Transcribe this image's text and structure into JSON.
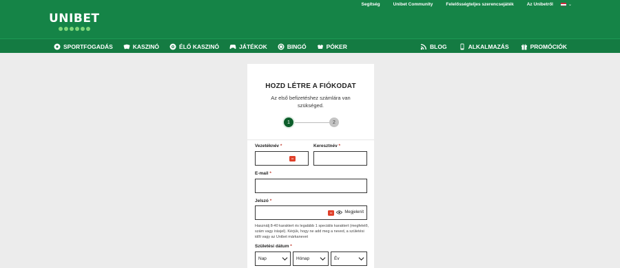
{
  "brand": {
    "name": "UNIBET"
  },
  "toplinks": [
    "Segítség",
    "Unibet Community",
    "Felelősségteljes szerencsejáték",
    "Az Unibetről"
  ],
  "language": {
    "flag_colors": [
      "#cd2a3e",
      "#ffffff",
      "#436f4d"
    ]
  },
  "nav": {
    "left": [
      {
        "label": "SPORTFOGADÁS",
        "icon": "sports-icon"
      },
      {
        "label": "KASZINÓ",
        "icon": "casino-icon"
      },
      {
        "label": "ÉLŐ KASZINÓ",
        "icon": "live-casino-icon"
      },
      {
        "label": "JÁTÉKOK",
        "icon": "games-icon"
      },
      {
        "label": "BINGÓ",
        "icon": "bingo-icon"
      },
      {
        "label": "PÓKER",
        "icon": "poker-icon"
      }
    ],
    "right": [
      {
        "label": "BLOG",
        "icon": "rss-icon"
      },
      {
        "label": "ALKALMAZÁS",
        "icon": "phone-icon"
      },
      {
        "label": "PROMÓCIÓK",
        "icon": "gift-icon"
      }
    ]
  },
  "form": {
    "title": "HOZD LÉTRE A FIÓKODAT",
    "subtitle": "Az első befizetéshez számlára van szükséged.",
    "steps": [
      "1",
      "2"
    ],
    "current_step": 1,
    "fields": {
      "lastname": {
        "label": "Vezetéknév",
        "value": ""
      },
      "firstname": {
        "label": "Keresztnév",
        "value": ""
      },
      "email": {
        "label": "E-mail",
        "value": ""
      },
      "password": {
        "label": "Jelszó",
        "value": "",
        "show_label": "Megjelenít"
      },
      "password_hint": "Használj 8-40 karaktert és legalább 1 speciális karaktert (megfelelő, szám vagy írásjel). Kérjük, hogy ne add meg a neved, a születési időt vagy az Unibet márkanevet",
      "birthdate": {
        "label": "Születési dátum",
        "day": "Nap",
        "month": "Hónap",
        "year": "Év"
      }
    },
    "required_mark": "*",
    "accent_color": "#0d5e2b"
  },
  "colors": {
    "header_bg": "#158447",
    "nav_bg": "#147b42",
    "page_bg": "#ececec"
  }
}
